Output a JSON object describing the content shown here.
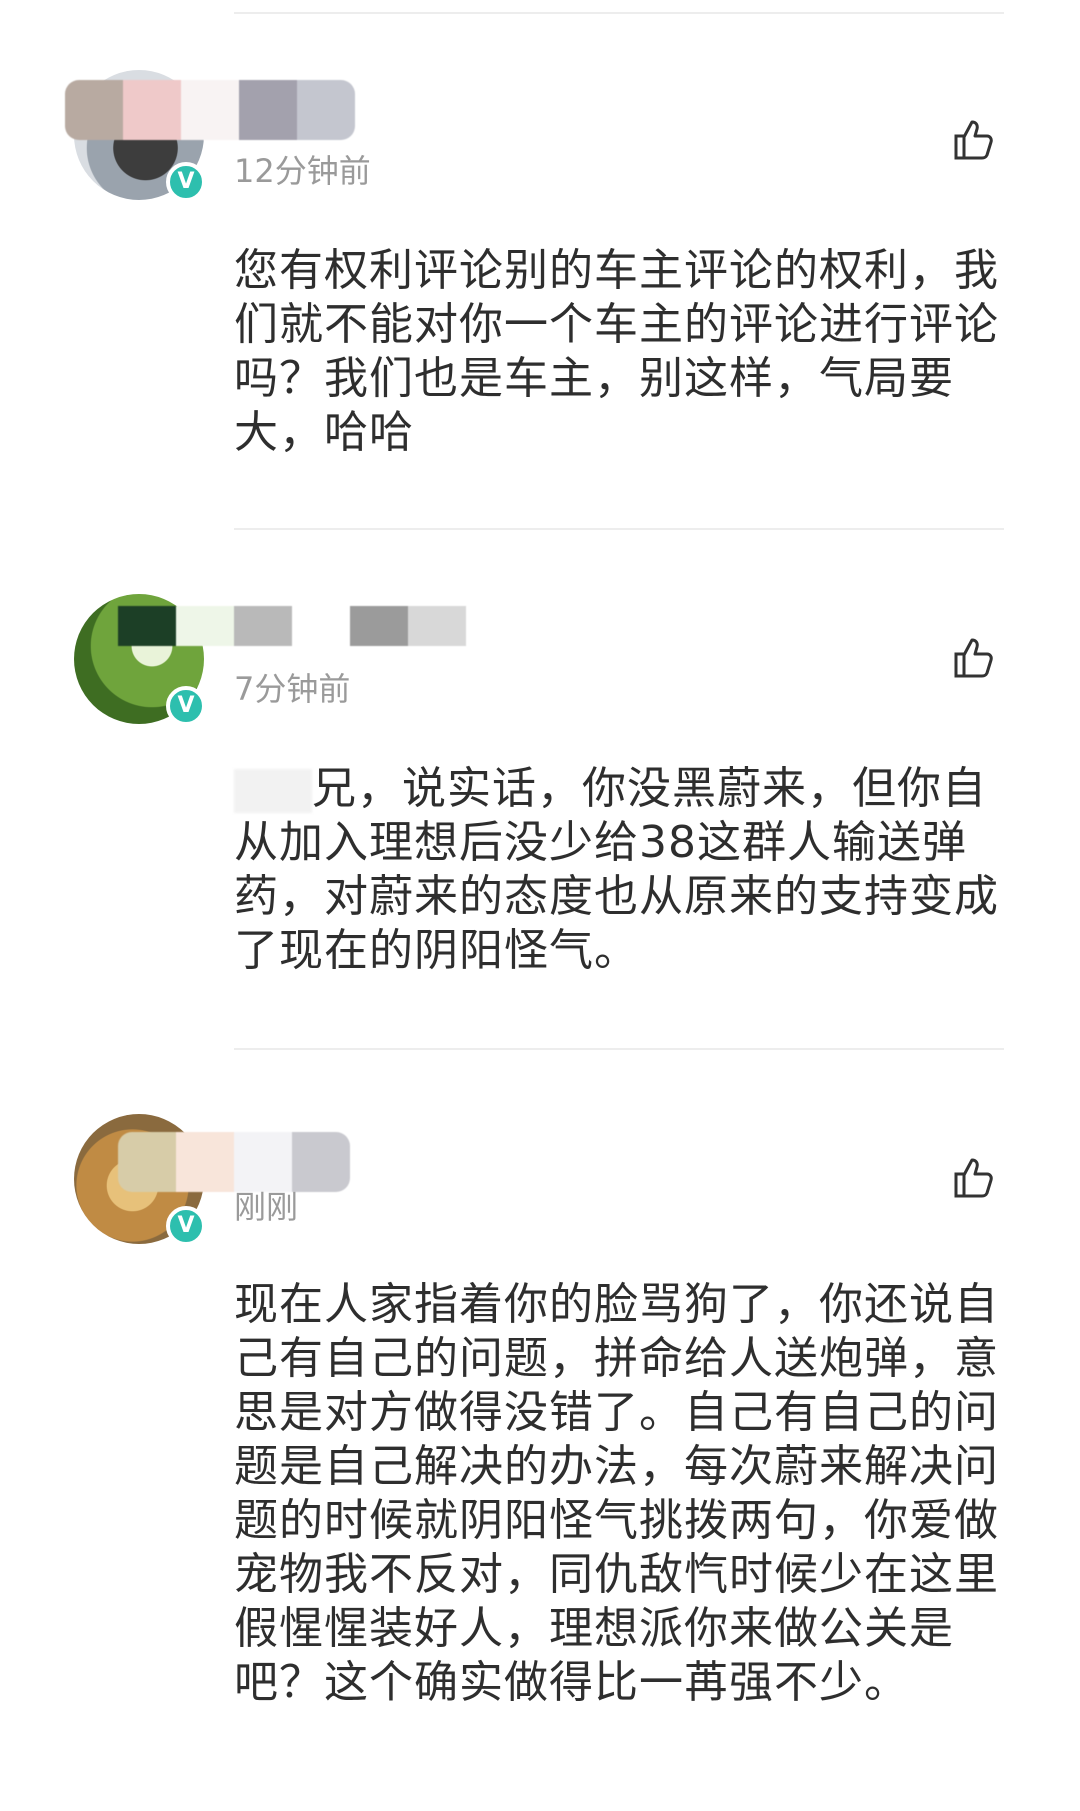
{
  "comments": [
    {
      "time": "12分钟前",
      "text": "您有权利评论别的车主评论的权利，我们就不能对你一个车主的评论进行评论吗？我们也是车主，别这样，气局要大，哈哈",
      "name_blocks": [
        "#b8aaa1",
        "#efc9c9",
        "#f8f3f3",
        "#a3a1ad",
        "#c4c6cf"
      ]
    },
    {
      "time": "7分钟前",
      "text_suffix": "兄，说实话，你没黑蔚来，但你自从加入理想后没少给38这群人输送弹药，对蔚来的态度也从原来的支持变成了现在的阴阳怪气。",
      "name_blocks": [
        "#1c3f26",
        "#eef6e8",
        "#b9b9b9",
        "#ffffff",
        "#9b9b9b",
        "#d8d8d8"
      ]
    },
    {
      "time": "刚刚",
      "text": "现在人家指着你的脸骂狗了，你还说自己有自己的问题，拼命给人送炮弹，意思是对方做得没错了。自己有自己的问题是自己解决的办法，每次蔚来解决问题的时候就阴阳怪气挑拨两句，你爱做宠物我不反对，同仇敌忾时候少在这里假惺惺装好人，理想派你来做公关是吧？这个确实做得比一苒强不少。",
      "name_blocks": [
        "#d7cca8",
        "#f8e5da",
        "#f3f3f6",
        "#c9c9cf"
      ]
    }
  ],
  "icons": {
    "like": "thumbs-up-icon",
    "verified": "verified-v-icon"
  },
  "colors": {
    "verified": "#2dbfae",
    "time": "#9a9a9a",
    "text": "#2e2e2e",
    "divider": "#ededed"
  }
}
